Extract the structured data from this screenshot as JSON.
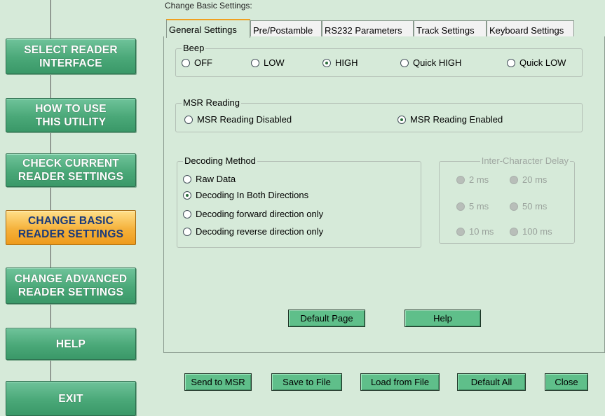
{
  "nav": {
    "select_reader": "SELECT READER\nINTERFACE",
    "how_to_use": "HOW TO USE\nTHIS UTILITY",
    "check_current": "CHECK CURRENT\nREADER SETTINGS",
    "change_basic": "CHANGE BASIC\nREADER SETTINGS",
    "change_advanced": "CHANGE ADVANCED\nREADER SETTINGS",
    "help": "HELP",
    "exit": "EXIT"
  },
  "group_caption": "Change Basic Settings:",
  "tabs": {
    "general": "General Settings",
    "pre_postamble": "Pre/Postamble",
    "rs232": "RS232 Parameters",
    "track": "Track Settings",
    "keyboard": "Keyboard Settings"
  },
  "beep": {
    "legend": "Beep",
    "off": "OFF",
    "low": "LOW",
    "high": "HIGH",
    "quick_high": "Quick HIGH",
    "quick_low": "Quick LOW",
    "selected": "HIGH"
  },
  "msr_reading": {
    "legend": "MSR Reading",
    "disabled": "MSR Reading Disabled",
    "enabled": "MSR Reading Enabled",
    "selected": "MSR Reading Enabled"
  },
  "decoding": {
    "legend": "Decoding Method",
    "raw": "Raw Data",
    "both": "Decoding In Both Directions",
    "forward": "Decoding forward direction only",
    "reverse": "Decoding reverse direction only",
    "selected": "Decoding In Both Directions"
  },
  "inter_char_delay": {
    "legend": "Inter-Character Delay",
    "ms2": "2 ms",
    "ms20": "20 ms",
    "ms5": "5 ms",
    "ms50": "50 ms",
    "ms10": "10 ms",
    "ms100": "100 ms"
  },
  "panel_buttons": {
    "default_page": "Default Page",
    "help": "Help"
  },
  "bottom_buttons": {
    "send": "Send to MSR",
    "save": "Save to File",
    "load": "Load from File",
    "default_all": "Default All",
    "close": "Close"
  },
  "colors": {
    "background": "#d6ead9",
    "nav_green": "#4aa878",
    "nav_active_orange": "#f5b13a",
    "button_green": "#5fbf8a"
  }
}
